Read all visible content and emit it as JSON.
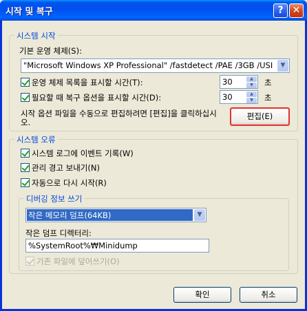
{
  "window": {
    "title": "시작 및 복구"
  },
  "titlebar": {
    "help_glyph": "?",
    "close_glyph": "✕"
  },
  "startup": {
    "group_title": "시스템 시작",
    "default_os_label": "기본 운영 체제(S):",
    "default_os_value": "\"Microsoft Windows XP Professional\" /fastdetect /PAE /3GB /USI",
    "show_list_label": "운영 체제 목록을 표시할 시간(T):",
    "show_list_checked": true,
    "show_list_value": "30",
    "show_recovery_label": "필요할 때 복구 옵션을 표시할 시간(D):",
    "show_recovery_checked": true,
    "show_recovery_value": "30",
    "seconds_unit": "초",
    "edit_hint": "시작 옵션 파일을 수동으로 편집하려면 [편집]을 클릭하십시오.",
    "edit_button": "편집(E)"
  },
  "failure": {
    "group_title": "시스템 오류",
    "write_event_label": "시스템 로그에 이벤트 기록(W)",
    "write_event_checked": true,
    "send_alert_label": "관리 경고 보내기(N)",
    "send_alert_checked": true,
    "auto_restart_label": "자동으로 다시 시작(R)",
    "auto_restart_checked": true,
    "debug": {
      "group_title": "디버깅 정보 쓰기",
      "dump_type_value": "작은 메모리 덤프(64KB)",
      "dump_dir_label": "작은 덤프 디렉터리:",
      "dump_dir_value": "%SystemRoot%₩Minidump",
      "overwrite_label": "기존 파일에 덮어쓰기(O)",
      "overwrite_checked": true
    }
  },
  "footer": {
    "ok_button": "확인",
    "cancel_button": "취소"
  },
  "colors": {
    "titlebar": "#0053ee",
    "group_title": "#0046d5",
    "selection": "#316ac5",
    "focus_border": "#e0322f"
  }
}
